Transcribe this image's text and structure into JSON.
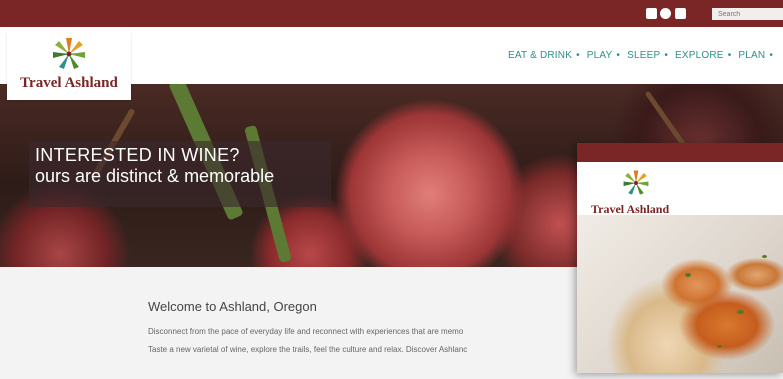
{
  "topbar": {
    "social_icons": [
      "facebook-icon",
      "instagram-icon",
      "youtube-icon"
    ],
    "search_placeholder": "Search"
  },
  "brand": {
    "name": "Travel Ashland",
    "colors": {
      "primary": "#7a2626",
      "nav": "#2e8f8c"
    }
  },
  "nav": {
    "items": [
      "EAT & DRINK",
      "PLAY",
      "SLEEP",
      "EXPLORE",
      "PLAN"
    ],
    "separator": "•"
  },
  "hero": {
    "line1": "INTERESTED IN WINE?",
    "line2": "ours are distinct & memorable"
  },
  "intro": {
    "heading": "Welcome to Ashland, Oregon",
    "line1": "Disconnect from the pace of everyday life and reconnect with experiences that are memo",
    "line2": "Taste a new varietal of wine, explore the trails, feel the culture and relax. Discover Ashlanc"
  },
  "mobile": {
    "brand_name": "Travel Ashland"
  }
}
